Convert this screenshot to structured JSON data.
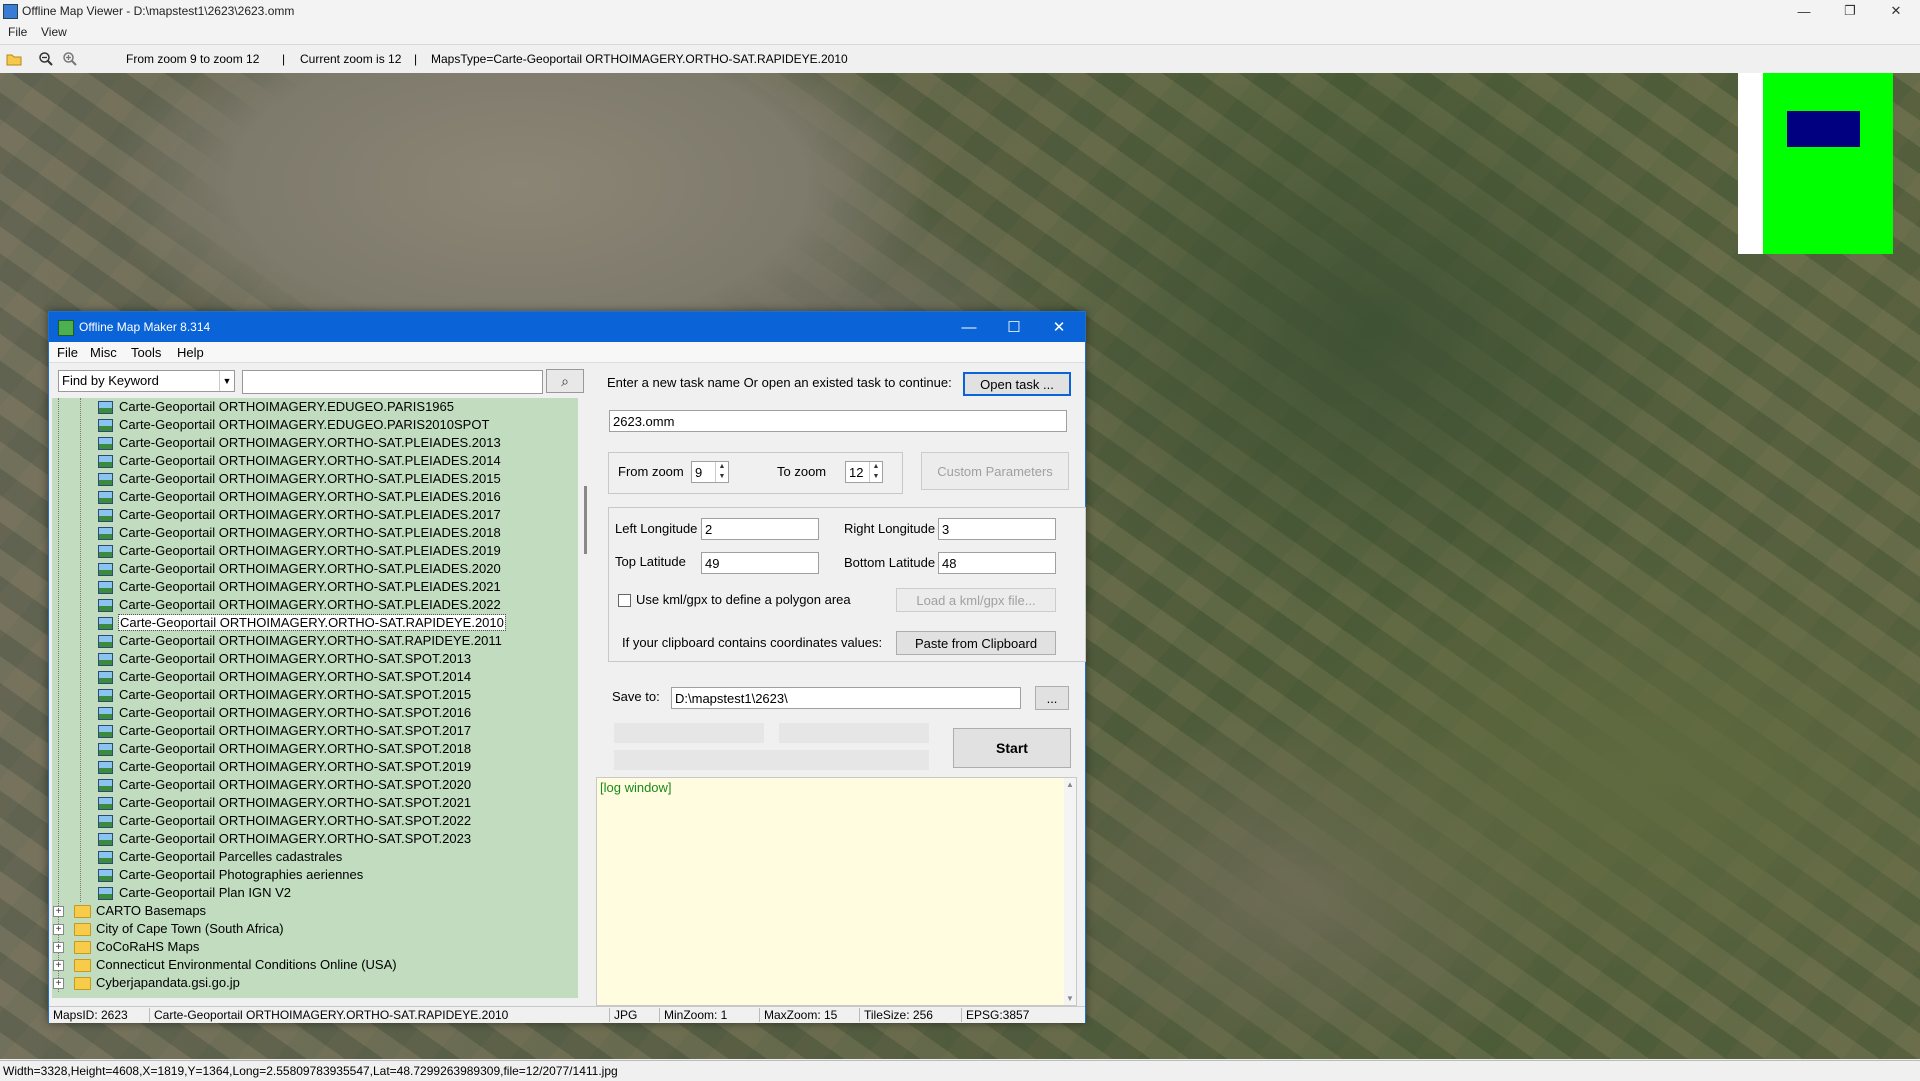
{
  "outer": {
    "title": "Offline Map Viewer - D:\\mapstest1\\2623\\2623.omm",
    "menu": [
      "File",
      "View"
    ],
    "toolbar": {
      "open_icon": "folder-open-icon",
      "zoom_out_icon": "zoom-out-icon",
      "zoom_in_icon": "zoom-in-icon",
      "zoom_range": "From zoom 9 to zoom 12",
      "current_zoom": "Current zoom is 12",
      "maps_type": "MapsType=Carte-Geoportail ORTHOIMAGERY.ORTHO-SAT.RAPIDEYE.2010"
    },
    "window_controls": {
      "minimize": "—",
      "restore": "❐",
      "close": "✕"
    },
    "status": "Width=3328,Height=4608,X=1819,Y=1364,Long=2.55809783935547,Lat=48.7299263989309,file=12/2077/1411.jpg",
    "minimap_colors": {
      "background": "#ffffff",
      "area": "#00ff00",
      "viewport": "#000080"
    }
  },
  "dialog": {
    "title": "Offline Map Maker 8.314",
    "window_controls": {
      "minimize": "—",
      "maximize": "☐",
      "close": "✕"
    },
    "menu": [
      "File",
      "Misc",
      "Tools",
      "Help"
    ],
    "search": {
      "mode": "Find by Keyword",
      "query": ""
    },
    "tree": {
      "map_items": [
        "Carte-Geoportail ORTHOIMAGERY.EDUGEO.PARIS1965",
        "Carte-Geoportail ORTHOIMAGERY.EDUGEO.PARIS2010SPOT",
        "Carte-Geoportail ORTHOIMAGERY.ORTHO-SAT.PLEIADES.2013",
        "Carte-Geoportail ORTHOIMAGERY.ORTHO-SAT.PLEIADES.2014",
        "Carte-Geoportail ORTHOIMAGERY.ORTHO-SAT.PLEIADES.2015",
        "Carte-Geoportail ORTHOIMAGERY.ORTHO-SAT.PLEIADES.2016",
        "Carte-Geoportail ORTHOIMAGERY.ORTHO-SAT.PLEIADES.2017",
        "Carte-Geoportail ORTHOIMAGERY.ORTHO-SAT.PLEIADES.2018",
        "Carte-Geoportail ORTHOIMAGERY.ORTHO-SAT.PLEIADES.2019",
        "Carte-Geoportail ORTHOIMAGERY.ORTHO-SAT.PLEIADES.2020",
        "Carte-Geoportail ORTHOIMAGERY.ORTHO-SAT.PLEIADES.2021",
        "Carte-Geoportail ORTHOIMAGERY.ORTHO-SAT.PLEIADES.2022",
        "Carte-Geoportail ORTHOIMAGERY.ORTHO-SAT.RAPIDEYE.2010",
        "Carte-Geoportail ORTHOIMAGERY.ORTHO-SAT.RAPIDEYE.2011",
        "Carte-Geoportail ORTHOIMAGERY.ORTHO-SAT.SPOT.2013",
        "Carte-Geoportail ORTHOIMAGERY.ORTHO-SAT.SPOT.2014",
        "Carte-Geoportail ORTHOIMAGERY.ORTHO-SAT.SPOT.2015",
        "Carte-Geoportail ORTHOIMAGERY.ORTHO-SAT.SPOT.2016",
        "Carte-Geoportail ORTHOIMAGERY.ORTHO-SAT.SPOT.2017",
        "Carte-Geoportail ORTHOIMAGERY.ORTHO-SAT.SPOT.2018",
        "Carte-Geoportail ORTHOIMAGERY.ORTHO-SAT.SPOT.2019",
        "Carte-Geoportail ORTHOIMAGERY.ORTHO-SAT.SPOT.2020",
        "Carte-Geoportail ORTHOIMAGERY.ORTHO-SAT.SPOT.2021",
        "Carte-Geoportail ORTHOIMAGERY.ORTHO-SAT.SPOT.2022",
        "Carte-Geoportail ORTHOIMAGERY.ORTHO-SAT.SPOT.2023",
        "Carte-Geoportail Parcelles cadastrales",
        "Carte-Geoportail Photographies aeriennes",
        "Carte-Geoportail Plan IGN V2"
      ],
      "selected_index": 12,
      "folders": [
        "CARTO Basemaps",
        "City of Cape Town (South Africa)",
        "CoCoRaHS Maps",
        "Connecticut Environmental Conditions Online (USA)",
        "Cyberjapandata.gsi.go.jp"
      ]
    },
    "task": {
      "prompt": "Enter a new task name Or open an existed task to continue:",
      "open_button": "Open task ...",
      "name": "2623.omm"
    },
    "zoom": {
      "from_label": "From zoom",
      "from_value": "9",
      "to_label": "To zoom",
      "to_value": "12",
      "custom_button": "Custom Parameters"
    },
    "coords": {
      "left_label": "Left Longitude",
      "left_value": "2",
      "right_label": "Right Longitude",
      "right_value": "3",
      "top_label": "Top Latitude",
      "top_value": "49",
      "bottom_label": "Bottom Latitude",
      "bottom_value": "48",
      "kml_label": "Use kml/gpx to define a polygon area",
      "kml_checked": false,
      "kml_button": "Load a kml/gpx file...",
      "clipboard_label": "If your clipboard contains coordinates values:",
      "clipboard_button": "Paste from Clipboard"
    },
    "save": {
      "label": "Save to:",
      "path": "D:\\mapstest1\\2623\\",
      "browse_button": "...",
      "start_button": "Start"
    },
    "log": {
      "text": "[log window]",
      "background": "#fffce0"
    },
    "status": {
      "maps_id": "MapsID: 2623",
      "map_name": "Carte-Geoportail ORTHOIMAGERY.ORTHO-SAT.RAPIDEYE.2010",
      "format": "JPG",
      "min_zoom": "MinZoom: 1",
      "max_zoom": "MaxZoom: 15",
      "tile_size": "TileSize: 256",
      "epsg": "EPSG:3857"
    }
  }
}
